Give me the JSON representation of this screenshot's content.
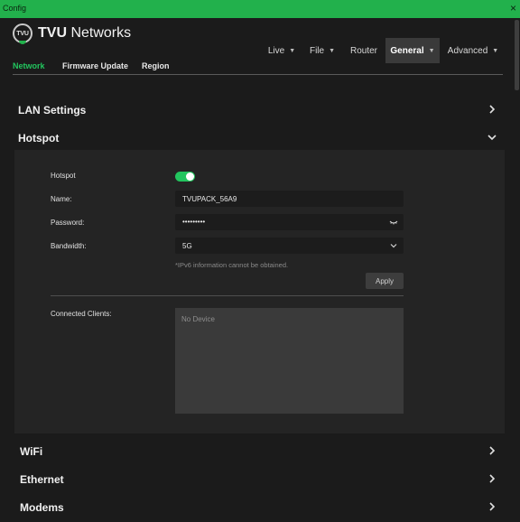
{
  "window": {
    "title": "Config",
    "close": "×"
  },
  "brand": {
    "badge": "TVU",
    "name_bold": "TVU",
    "name_rest": " Networks"
  },
  "nav": {
    "items": [
      {
        "label": "Live",
        "caret": "▼"
      },
      {
        "label": "File",
        "caret": "▼"
      },
      {
        "label": "Router",
        "caret": ""
      },
      {
        "label": "General",
        "caret": "▼",
        "active": true
      },
      {
        "label": "Advanced",
        "caret": "▼"
      }
    ]
  },
  "subtabs": [
    {
      "label": "Network",
      "active": true
    },
    {
      "label": "Firmware Update"
    },
    {
      "label": "Region"
    }
  ],
  "sections": {
    "lan": "LAN Settings",
    "hotspot": "Hotspot",
    "wifi": "WiFi",
    "ethernet": "Ethernet",
    "modems": "Modems"
  },
  "hotspot": {
    "toggle_label": "Hotspot",
    "enabled": true,
    "name_label": "Name:",
    "name_value": "TVUPACK_56A9",
    "password_label": "Password:",
    "password_value": "•••••••••",
    "bandwidth_label": "Bandwidth:",
    "bandwidth_value": "5G",
    "ipv6_note": "*IPv6 information cannot be obtained.",
    "apply_label": "Apply",
    "clients_label": "Connected Clients:",
    "clients_empty": "No Device"
  },
  "colors": {
    "accent": "#22c55e",
    "titlebar": "#22b14c",
    "background": "#1b1b1b",
    "panel": "#242424"
  }
}
